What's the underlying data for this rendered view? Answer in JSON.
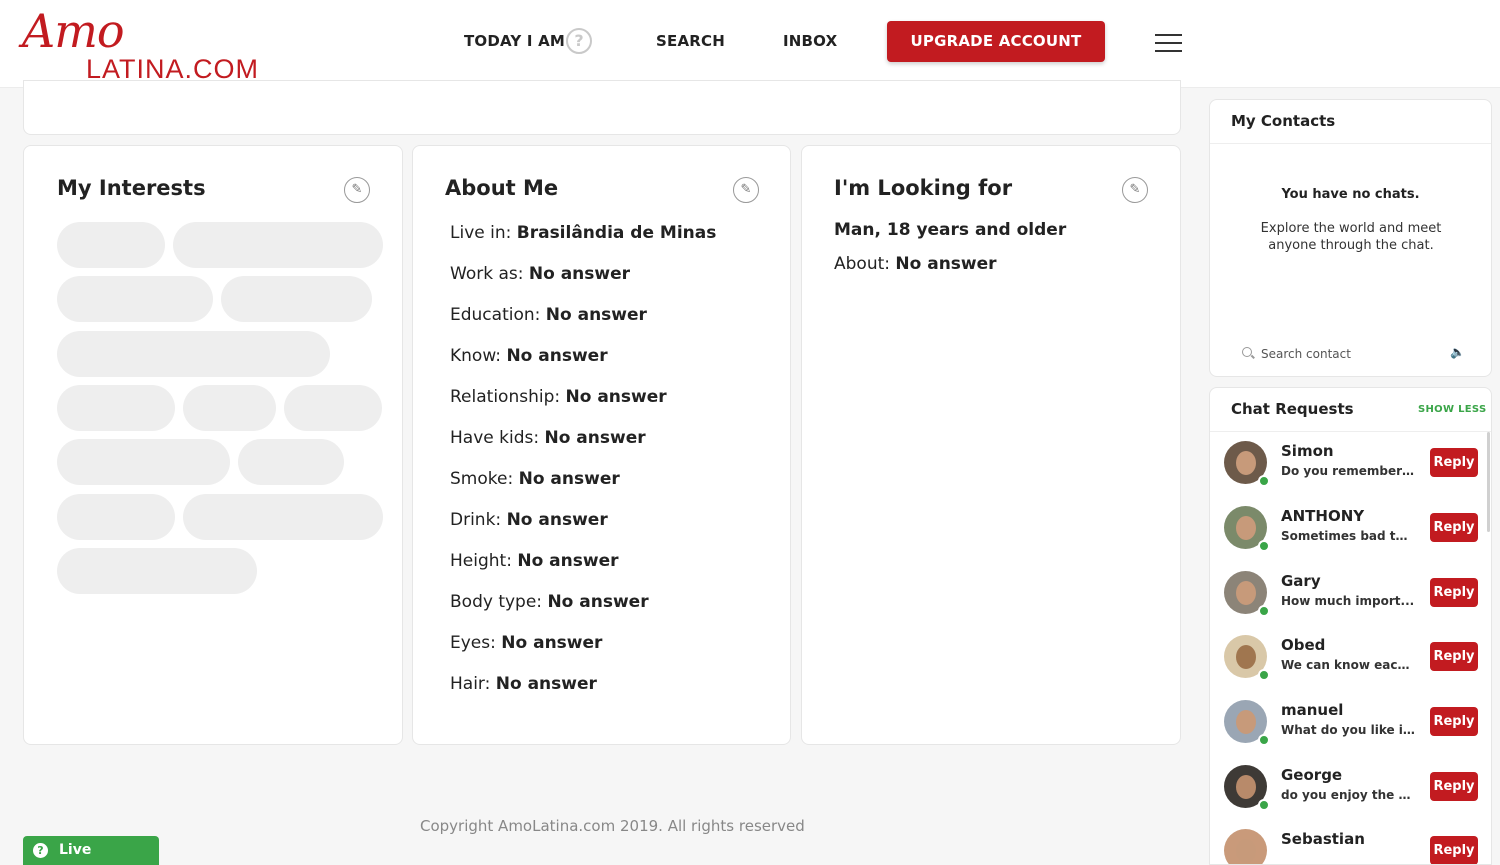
{
  "header": {
    "logo_script": "Amo",
    "logo_main": "LATINA.COM",
    "nav_today": "TODAY I AM",
    "help_glyph": "?",
    "nav_search": "SEARCH",
    "nav_inbox": "INBOX",
    "upgrade_label": "UPGRADE ACCOUNT",
    "menu_icon": "hamburger-icon"
  },
  "interests": {
    "title": "My Interests",
    "edit_icon": "pencil-icon"
  },
  "about": {
    "title": "About Me",
    "edit_icon": "pencil-icon",
    "rows": [
      {
        "label": "Live in:",
        "value": "Brasilândia de Minas"
      },
      {
        "label": "Work as:",
        "value": "No answer"
      },
      {
        "label": "Education:",
        "value": "No answer"
      },
      {
        "label": "Know:",
        "value": "No answer"
      },
      {
        "label": "Relationship:",
        "value": "No answer"
      },
      {
        "label": "Have kids:",
        "value": "No answer"
      },
      {
        "label": "Smoke:",
        "value": "No answer"
      },
      {
        "label": "Drink:",
        "value": "No answer"
      },
      {
        "label": "Height:",
        "value": "No answer"
      },
      {
        "label": "Body type:",
        "value": "No answer"
      },
      {
        "label": "Eyes:",
        "value": "No answer"
      },
      {
        "label": "Hair:",
        "value": "No answer"
      }
    ]
  },
  "looking": {
    "title": "I'm Looking for",
    "edit_icon": "pencil-icon",
    "summary": "Man, 18 years and older",
    "about_label": "About:",
    "about_value": "No answer"
  },
  "footer": {
    "copyright": "Copyright AmoLatina.com 2019. All rights reserved",
    "live_support": "Live Support",
    "live_support_glyph": "?"
  },
  "contacts": {
    "title": "My Contacts",
    "no_chats": "You have no chats.",
    "explore": "Explore the world and meet anyone through the chat.",
    "search_placeholder": "Search contact",
    "sound_icon": "speaker-icon"
  },
  "requests": {
    "title": "Chat Requests",
    "toggle": "SHOW LESS",
    "reply_label": "Reply",
    "items": [
      {
        "name": "Simon",
        "message": "Do you remember ..."
      },
      {
        "name": "ANTHONY",
        "message": "Sometimes bad thi..."
      },
      {
        "name": "Gary",
        "message": "How much import..."
      },
      {
        "name": "Obed",
        "message": "We can know each ..."
      },
      {
        "name": "manuel",
        "message": "What do you like i..."
      },
      {
        "name": "George",
        "message": "do you enjoy the p..."
      },
      {
        "name": "Sebastian",
        "message": ""
      }
    ]
  },
  "colors": {
    "brand_red": "#c21b20",
    "online_green": "#3aa548",
    "skeleton_grey": "#eeeeee"
  }
}
